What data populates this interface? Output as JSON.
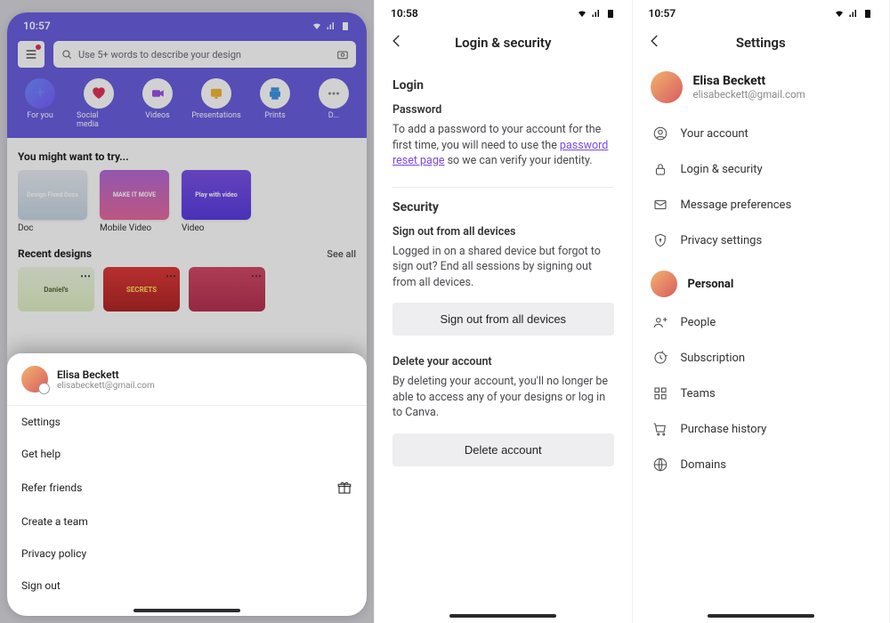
{
  "phone1": {
    "time": "10:57",
    "search_placeholder": "Use 5+ words to describe your design",
    "categories": [
      {
        "id": "for-you",
        "label": "For you"
      },
      {
        "id": "social-media",
        "label": "Social media"
      },
      {
        "id": "videos",
        "label": "Videos"
      },
      {
        "id": "presentations",
        "label": "Presentations"
      },
      {
        "id": "prints",
        "label": "Prints"
      },
      {
        "id": "more",
        "label": "D..."
      }
    ],
    "might_try_heading": "You might want to try...",
    "might_try": [
      {
        "label": "Doc"
      },
      {
        "label": "Mobile Video"
      },
      {
        "label": "Video"
      }
    ],
    "recent_heading": "Recent designs",
    "see_all": "See all",
    "recent": [
      {
        "label": "Daniel's"
      },
      {
        "label": "SECRETS"
      },
      {
        "label": ""
      }
    ],
    "sheet": {
      "name": "Elisa Beckett",
      "email": "elisabeckett@gmail.com",
      "items": [
        {
          "label": "Settings",
          "id": "settings"
        },
        {
          "label": "Get help",
          "id": "get-help"
        },
        {
          "label": "Refer friends",
          "id": "refer-friends",
          "icon": "gift"
        },
        {
          "label": "Create a team",
          "id": "create-team"
        },
        {
          "label": "Privacy policy",
          "id": "privacy-policy"
        },
        {
          "label": "Sign out",
          "id": "sign-out"
        }
      ]
    }
  },
  "phone2": {
    "time": "10:58",
    "title": "Login & security",
    "login_section": "Login",
    "password_heading": "Password",
    "password_body_pre": "To add a password to your account for the first time, you will need to use the ",
    "password_link": "password reset page",
    "password_body_post": " so we can verify your identity.",
    "security_section": "Security",
    "signout_heading": "Sign out from all devices",
    "signout_body": "Logged in on a shared device but forgot to sign out? End all sessions by signing out from all devices.",
    "signout_button": "Sign out from all devices",
    "delete_heading": "Delete your account",
    "delete_body": "By deleting your account, you'll no longer be able to access any of your designs or log in to Canva.",
    "delete_button": "Delete account"
  },
  "phone3": {
    "time": "10:57",
    "title": "Settings",
    "user_name": "Elisa Beckett",
    "user_email": "elisabeckett@gmail.com",
    "account_items": [
      {
        "label": "Your account",
        "icon": "user-circle",
        "id": "your-account"
      },
      {
        "label": "Login & security",
        "icon": "lock",
        "id": "login-security"
      },
      {
        "label": "Message preferences",
        "icon": "mail",
        "id": "message-preferences"
      },
      {
        "label": "Privacy settings",
        "icon": "shield-lock",
        "id": "privacy-settings"
      }
    ],
    "personal_label": "Personal",
    "personal_items": [
      {
        "label": "People",
        "icon": "people",
        "id": "people"
      },
      {
        "label": "Subscription",
        "icon": "subscription",
        "id": "subscription"
      },
      {
        "label": "Teams",
        "icon": "teams",
        "id": "teams"
      },
      {
        "label": "Purchase history",
        "icon": "cart",
        "id": "purchase-history"
      },
      {
        "label": "Domains",
        "icon": "globe",
        "id": "domains"
      }
    ]
  }
}
